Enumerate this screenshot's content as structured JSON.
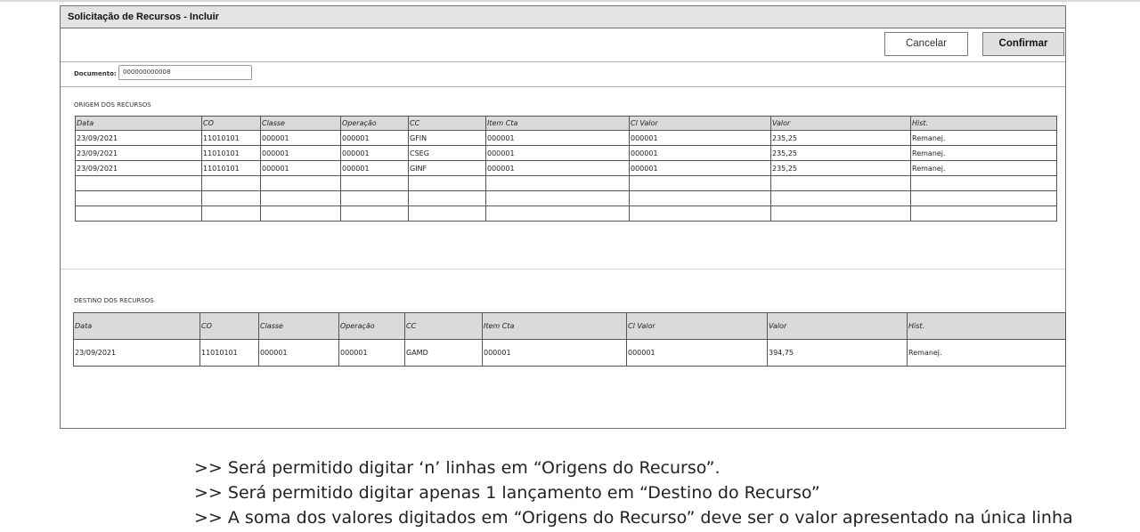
{
  "window": {
    "title": "Solicitação de Recursos - Incluir"
  },
  "buttons": {
    "cancel": "Cancelar",
    "confirm": "Confirmar"
  },
  "document": {
    "label": "Documento:",
    "value": "000000000008"
  },
  "origin": {
    "section_title": "ORIGEM DOS RECURSOS",
    "columns": [
      "Data",
      "CO",
      "Classe",
      "Operação",
      "CC",
      "Item Cta",
      "Cl Valor",
      "Valor",
      "Hist."
    ],
    "rows": [
      [
        "23/09/2021",
        "11010101",
        "000001",
        "000001",
        "GFIN",
        "000001",
        "000001",
        "235,25",
        "Remanej."
      ],
      [
        "23/09/2021",
        "11010101",
        "000001",
        "000001",
        "CSEG",
        "000001",
        "000001",
        "235,25",
        "Remanej."
      ],
      [
        "23/09/2021",
        "11010101",
        "000001",
        "000001",
        "GINF",
        "000001",
        "000001",
        "235,25",
        "Remanej."
      ],
      [
        "",
        "",
        "",
        "",
        "",
        "",
        "",
        "",
        ""
      ],
      [
        "",
        "",
        "",
        "",
        "",
        "",
        "",
        "",
        ""
      ],
      [
        "",
        "",
        "",
        "",
        "",
        "",
        "",
        "",
        ""
      ]
    ]
  },
  "destination": {
    "section_title": "DESTINO DOS RECURSOS",
    "columns": [
      "Data",
      "CO",
      "Classe",
      "Operação",
      "CC",
      "Item Cta",
      "Cl Valor",
      "Valor",
      "Hist."
    ],
    "rows": [
      [
        "23/09/2021",
        "11010101",
        "000001",
        "000001",
        "GAMD",
        "000001",
        "000001",
        "394,75",
        "Remanej."
      ]
    ]
  },
  "notes": [
    ">> Será permitido digitar ‘n’ linhas em “Origens do Recurso”.",
    ">> Será permitido digitar apenas 1 lançamento em “Destino do Recurso”",
    ">> A soma dos valores digitados em “Origens do Recurso” deve ser o valor apresentado na única linha"
  ]
}
